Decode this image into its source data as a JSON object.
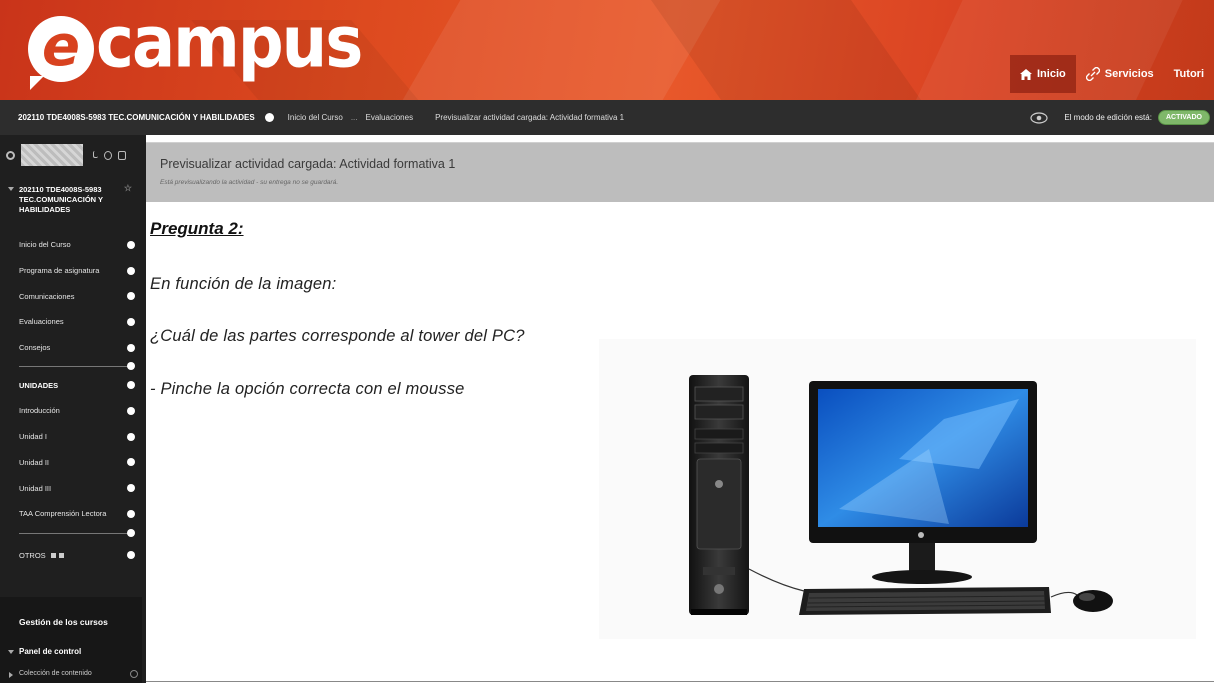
{
  "header": {
    "logo_text": "campus",
    "logo_e": "e",
    "nav": [
      {
        "label": "Inicio",
        "icon": "home-icon",
        "active": true
      },
      {
        "label": "Servicios",
        "icon": "link-icon",
        "active": false
      },
      {
        "label": "Tutori",
        "icon": "",
        "active": false
      }
    ]
  },
  "coursebar": {
    "course": "202110 TDE4008S-5983 TEC.COMUNICACIÓN Y HABILIDADES",
    "breadcrumbs": [
      "Inicio del Curso",
      "Evaluaciones",
      "Previsualizar actividad cargada: Actividad formativa 1"
    ],
    "separator": "...",
    "edit_mode_label": "El modo de edición está:",
    "edit_mode_value": "ACTIVADO"
  },
  "sidebar": {
    "course_title": "202110 TDE4008S-5983 TEC.COMUNICACIÓN Y HABILIDADES",
    "items_group1": [
      "Inicio del Curso",
      "Programa de asignatura",
      "Comunicaciones",
      "Evaluaciones",
      "Consejos"
    ],
    "heading_units": "UNIDADES",
    "items_group2": [
      "Introducción",
      "Unidad I",
      "Unidad II",
      "Unidad III",
      "TAA Comprensión Lectora"
    ],
    "item_otros": "OTROS",
    "management_title": "Gestión de los cursos",
    "control_panel": "Panel de control",
    "content_collection": "Colección de contenido"
  },
  "main": {
    "preview_title": "Previsualizar actividad cargada: Actividad formativa 1",
    "preview_subtitle": "Está previsualizando la actividad - su entrega no se guardará.",
    "question_title": "Pregunta 2:",
    "line1": "En función de la imagen:",
    "line2": "¿Cuál de las partes corresponde  al tower del PC?",
    "line3": "- Pinche la opción correcta con el mousse",
    "image": "desktop-computer-image"
  },
  "colors": {
    "banner": "#dd4a1f",
    "coursebar": "#2d2d2d",
    "sidebar": "#1f1f1f",
    "preview_bar": "#bdbdbd",
    "toggle_on": "#7fb86a"
  }
}
